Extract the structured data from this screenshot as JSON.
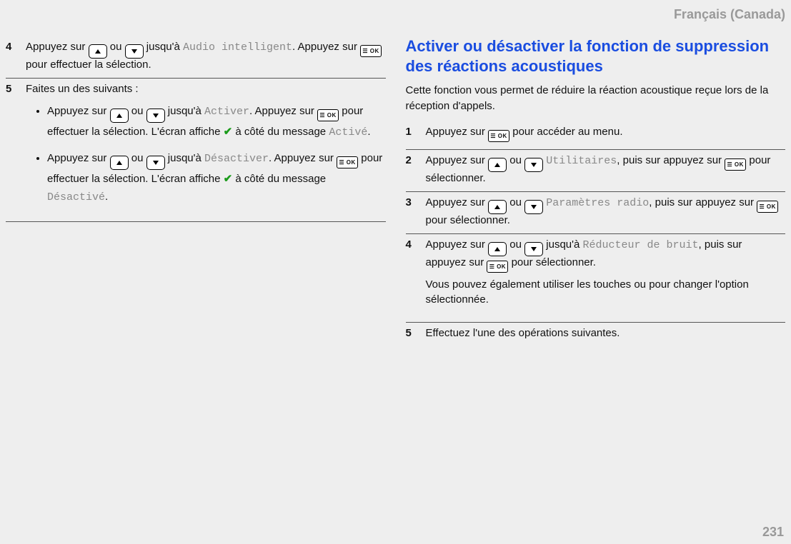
{
  "header": {
    "locale": "Français (Canada)"
  },
  "page_number": "231",
  "left": {
    "step4": {
      "num": "4",
      "t1": "Appuyez sur",
      "or": "ou",
      "t2": "jusqu'à",
      "mono": "Audio intelligent",
      "t3": ". Appuyez sur",
      "t4": "pour effectuer la sélection."
    },
    "step5": {
      "num": "5",
      "intro": "Faites un des suivants :",
      "itemA": {
        "t1": "Appuyez sur",
        "or": "ou",
        "t2": "jusqu'à",
        "mono": "Activer",
        "period": ".",
        "t3": "Appuyez sur",
        "t4": "pour effectuer la sélection. L'écran affiche",
        "t5": "à côté du message",
        "mono2": "Activé",
        "period2": "."
      },
      "itemB": {
        "t1": "Appuyez sur",
        "or": "ou",
        "t2": "jusqu'à",
        "mono": "Désactiver",
        "period": ".",
        "t3": "Appuyez sur",
        "t4": "pour effectuer la sélection. L'écran affiche",
        "t5": "à côté du message",
        "mono2": "Désactivé",
        "period2": "."
      }
    }
  },
  "right": {
    "title": "Activer ou désactiver la fonction de suppression des réactions acoustiques",
    "intro": "Cette fonction vous permet de réduire la réaction acoustique reçue lors de la réception d'appels.",
    "s1": {
      "num": "1",
      "t1": "Appuyez sur",
      "t2": "pour accéder au menu."
    },
    "s2": {
      "num": "2",
      "t1": "Appuyez sur",
      "or": "ou",
      "mono": "Utilitaires",
      "t2": ", puis sur appuyez sur",
      "t3": "pour sélectionner."
    },
    "s3": {
      "num": "3",
      "t1": "Appuyez sur",
      "or": "ou",
      "mono": "Paramètres radio",
      "t2": ", puis sur appuyez sur",
      "t3": "pour sélectionner."
    },
    "s4": {
      "num": "4",
      "t1": "Appuyez sur",
      "or": "ou",
      "t2": "jusqu'à",
      "mono": "Réducteur de bruit",
      "t3": ", puis sur appuyez sur",
      "t4": "pour sélectionner.",
      "note": "Vous pouvez également utiliser les touches ou pour changer l'option sélectionnée."
    },
    "s5": {
      "num": "5",
      "t": "Effectuez l'une des opérations suivantes."
    }
  },
  "icons": {
    "ok": "☰ OK",
    "check": "✔"
  }
}
